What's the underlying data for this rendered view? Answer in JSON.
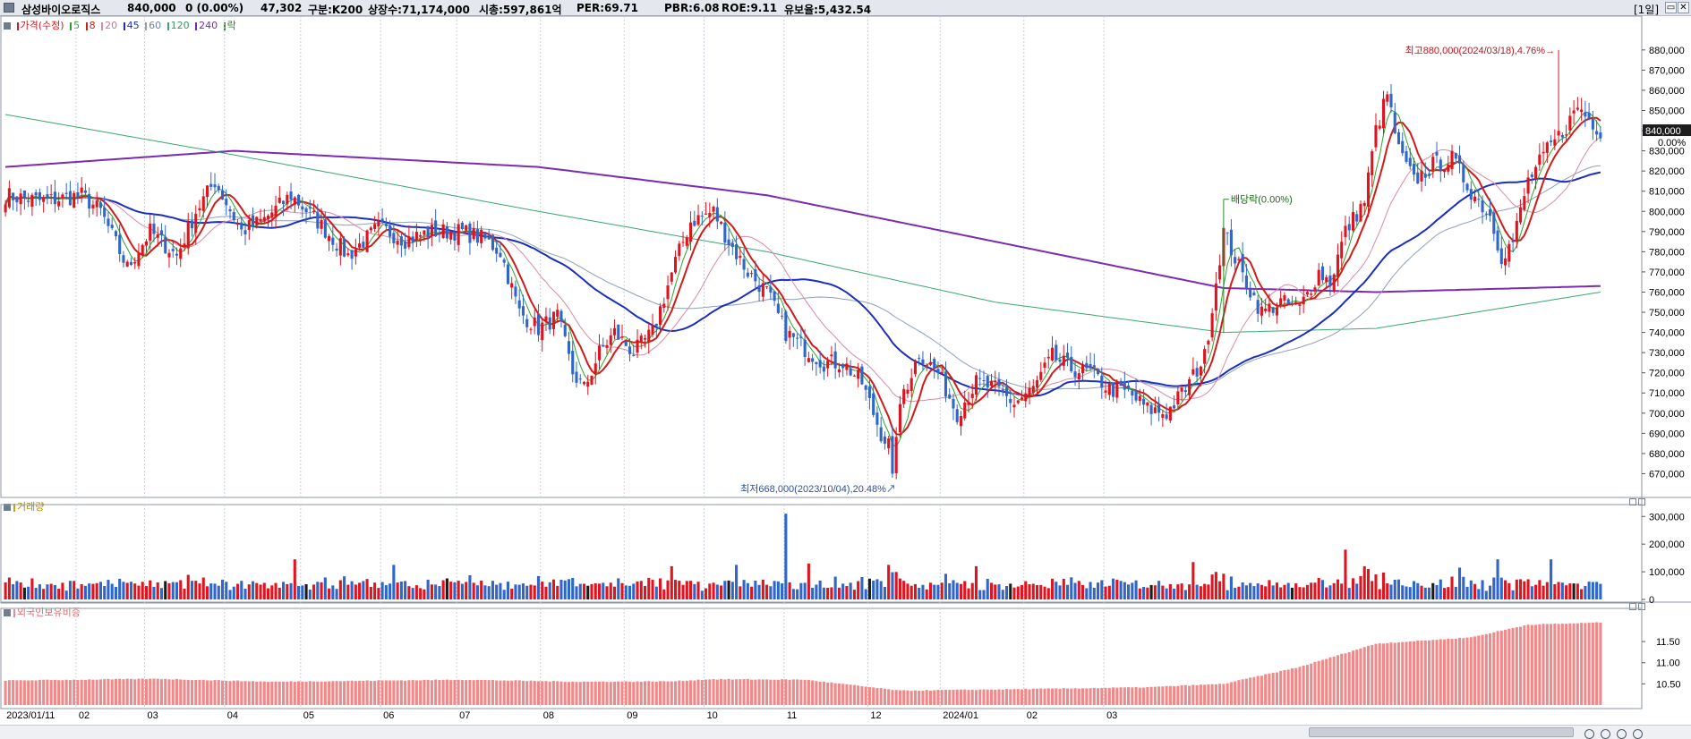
{
  "header": {
    "name": "삼성바이오로직스",
    "price": "840,000",
    "change": "0 (0.00%)",
    "volume": "47,302",
    "index": "구분:K200",
    "shares": "상장수:71,174,000",
    "mktcap": "시총:597,861억",
    "per": "PER:69.71",
    "pbr": "PBR:6.08",
    "roe": "ROE:9.11",
    "reserve": "유보율:5,432.54",
    "period": "[1일]",
    "btn_restore": "▭",
    "btn_close": "✕"
  },
  "legend": {
    "price": "가격(수정)",
    "ma5": "5",
    "ma8": "8",
    "ma20": "20",
    "ma45": "45",
    "ma60": "60",
    "ma120": "120",
    "ma240": "240",
    "ex": "락"
  },
  "colors": {
    "up": "#e0141e",
    "down": "#2f66c8",
    "ma5": "#2aa52a",
    "ma8": "#d21a1a",
    "ma20": "#d98aa6",
    "ma45": "#1a2fbf",
    "ma60": "#8ea0b8",
    "ma120": "#38a870",
    "ma240": "#7a2ab3",
    "foreign": "#f08a8a"
  },
  "chart_data": [
    {
      "type": "candlestick",
      "title": "",
      "ylim": [
        660000,
        895000
      ],
      "y_ticks": [
        "880,000",
        "870,000",
        "860,000",
        "850,000",
        "840,000",
        "830,000",
        "820,000",
        "810,000",
        "800,000",
        "790,000",
        "780,000",
        "770,000",
        "760,000",
        "750,000",
        "740,000",
        "730,000",
        "720,000",
        "710,000",
        "700,000",
        "690,000",
        "680,000",
        "670,000"
      ],
      "x_labels": [
        "2023/01/11",
        "02",
        "03",
        "04",
        "05",
        "06",
        "07",
        "08",
        "09",
        "10",
        "11",
        "12",
        "2024/01",
        "02",
        "03"
      ],
      "close_keypoints": [
        [
          0,
          808000
        ],
        [
          10,
          805000
        ],
        [
          20,
          808000
        ],
        [
          25,
          800000
        ],
        [
          32,
          772000
        ],
        [
          38,
          790000
        ],
        [
          45,
          778000
        ],
        [
          50,
          800000
        ],
        [
          55,
          815000
        ],
        [
          62,
          790000
        ],
        [
          68,
          796000
        ],
        [
          75,
          808000
        ],
        [
          82,
          795000
        ],
        [
          90,
          778000
        ],
        [
          98,
          792000
        ],
        [
          105,
          786000
        ],
        [
          112,
          790000
        ],
        [
          120,
          790000
        ],
        [
          126,
          786000
        ],
        [
          130,
          780000
        ],
        [
          135,
          750000
        ],
        [
          140,
          742000
        ],
        [
          145,
          748000
        ],
        [
          149,
          720000
        ],
        [
          152,
          712000
        ],
        [
          156,
          730000
        ],
        [
          160,
          740000
        ],
        [
          165,
          730000
        ],
        [
          170,
          740000
        ],
        [
          176,
          775000
        ],
        [
          180,
          795000
        ],
        [
          186,
          800000
        ],
        [
          190,
          785000
        ],
        [
          195,
          770000
        ],
        [
          200,
          760000
        ],
        [
          205,
          740000
        ],
        [
          210,
          732000
        ],
        [
          215,
          725000
        ],
        [
          220,
          725000
        ],
        [
          225,
          715000
        ],
        [
          230,
          690000
        ],
        [
          233,
          682000
        ],
        [
          236,
          710000
        ],
        [
          240,
          730000
        ],
        [
          245,
          720000
        ],
        [
          250,
          700000
        ],
        [
          255,
          715000
        ],
        [
          260,
          712000
        ],
        [
          265,
          705000
        ],
        [
          270,
          712000
        ],
        [
          275,
          728000
        ],
        [
          280,
          722000
        ],
        [
          285,
          720000
        ],
        [
          290,
          712000
        ],
        [
          295,
          710000
        ],
        [
          300,
          702000
        ],
        [
          305,
          700000
        ],
        [
          310,
          712000
        ],
        [
          315,
          728000
        ],
        [
          320,
          790000
        ],
        [
          325,
          768000
        ],
        [
          330,
          750000
        ],
        [
          335,
          755000
        ],
        [
          340,
          752000
        ],
        [
          345,
          770000
        ],
        [
          348,
          765000
        ],
        [
          352,
          790000
        ],
        [
          357,
          805000
        ],
        [
          360,
          840000
        ],
        [
          363,
          858000
        ],
        [
          366,
          830000
        ],
        [
          370,
          815000
        ],
        [
          375,
          823000
        ],
        [
          380,
          826000
        ],
        [
          385,
          810000
        ],
        [
          390,
          798000
        ],
        [
          393,
          778000
        ],
        [
          396,
          785000
        ],
        [
          400,
          815000
        ],
        [
          405,
          830000
        ],
        [
          410,
          842000
        ],
        [
          413,
          852000
        ],
        [
          416,
          846000
        ],
        [
          419,
          840000
        ]
      ],
      "annotations": [
        "최고880,000(2024/03/18),4.76%",
        "최저668,000(2023/10/04),20.48%",
        "배당락(0.00%)"
      ],
      "last_price_label": "840,000",
      "last_change_label": "0.00%"
    },
    {
      "type": "bar",
      "title": "거래량",
      "ylim": [
        0,
        330000
      ],
      "y_ticks": [
        "300,000",
        "200,000",
        "100,000",
        "0"
      ],
      "spikes": [
        [
          76,
          145000
        ],
        [
          102,
          125000
        ],
        [
          175,
          120000
        ],
        [
          192,
          125000
        ],
        [
          205,
          310000
        ],
        [
          211,
          130000
        ],
        [
          232,
          125000
        ],
        [
          255,
          120000
        ],
        [
          312,
          135000
        ],
        [
          352,
          180000
        ],
        [
          357,
          120000
        ],
        [
          382,
          115000
        ],
        [
          392,
          145000
        ],
        [
          406,
          145000
        ]
      ]
    },
    {
      "type": "bar",
      "title": "외국인보유비중",
      "ylim": [
        10.0,
        12.2
      ],
      "y_ticks": [
        "11.50",
        "11.00",
        "10.50"
      ],
      "keypoints": [
        [
          0,
          10.58
        ],
        [
          40,
          10.62
        ],
        [
          70,
          10.55
        ],
        [
          120,
          10.6
        ],
        [
          150,
          10.55
        ],
        [
          175,
          10.56
        ],
        [
          185,
          10.61
        ],
        [
          210,
          10.6
        ],
        [
          235,
          10.34
        ],
        [
          270,
          10.38
        ],
        [
          300,
          10.42
        ],
        [
          320,
          10.5
        ],
        [
          340,
          10.9
        ],
        [
          360,
          11.45
        ],
        [
          385,
          11.6
        ],
        [
          400,
          11.9
        ],
        [
          419,
          11.95
        ]
      ]
    }
  ],
  "footer": {
    "zoom_in": "+",
    "zoom_out": "−"
  }
}
